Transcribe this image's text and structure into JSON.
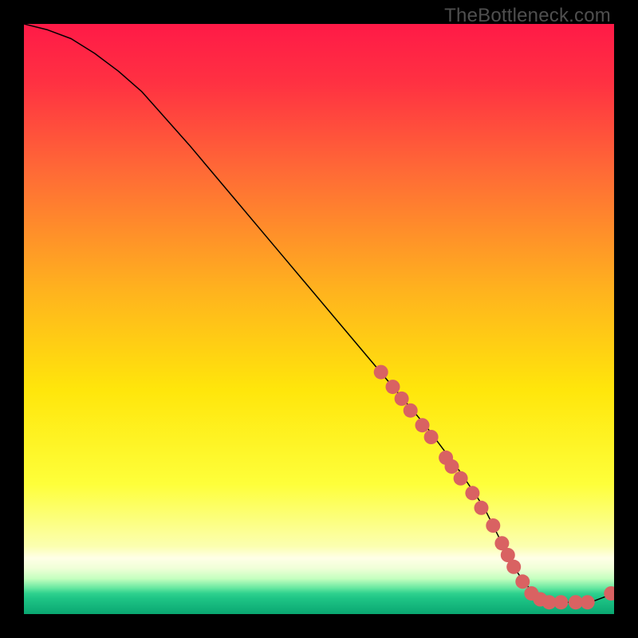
{
  "meta": {
    "watermark": "TheBottleneck.com"
  },
  "chart_data": {
    "type": "line",
    "title": "",
    "xlabel": "",
    "ylabel": "",
    "xlim": [
      0,
      100
    ],
    "ylim": [
      0,
      100
    ],
    "background_gradient": {
      "stops": [
        {
          "t": 0.0,
          "color": "#ff1a47"
        },
        {
          "t": 0.1,
          "color": "#ff3142"
        },
        {
          "t": 0.25,
          "color": "#ff6a36"
        },
        {
          "t": 0.45,
          "color": "#ffb21e"
        },
        {
          "t": 0.62,
          "color": "#ffe60b"
        },
        {
          "t": 0.78,
          "color": "#feff3a"
        },
        {
          "t": 0.885,
          "color": "#fbffb0"
        },
        {
          "t": 0.905,
          "color": "#ffffe7"
        },
        {
          "t": 0.922,
          "color": "#f0ffd8"
        },
        {
          "t": 0.94,
          "color": "#c4ffbf"
        },
        {
          "t": 0.956,
          "color": "#66e7a0"
        },
        {
          "t": 0.965,
          "color": "#2fd18e"
        },
        {
          "t": 0.973,
          "color": "#1fc586"
        },
        {
          "t": 1.0,
          "color": "#0aa771"
        }
      ]
    },
    "series": [
      {
        "name": "bottleneck-curve",
        "stroke": "#000000",
        "stroke_width": 1.5,
        "x": [
          0,
          4,
          8,
          12,
          16,
          20,
          28,
          36,
          44,
          52,
          60,
          68,
          74,
          78,
          81,
          83,
          85,
          88,
          92,
          96,
          100
        ],
        "y": [
          100,
          99,
          97.5,
          95,
          92,
          88.5,
          79.5,
          70,
          60.5,
          51,
          41.5,
          32,
          24,
          18,
          12,
          8,
          5,
          2.5,
          2,
          2,
          3.5
        ]
      }
    ],
    "markers": {
      "name": "highlight-points",
      "color": "#d96262",
      "radius": 9,
      "points": [
        {
          "x": 60.5,
          "y": 41
        },
        {
          "x": 62.5,
          "y": 38.5
        },
        {
          "x": 64.0,
          "y": 36.5
        },
        {
          "x": 65.5,
          "y": 34.5
        },
        {
          "x": 67.5,
          "y": 32
        },
        {
          "x": 69.0,
          "y": 30
        },
        {
          "x": 71.5,
          "y": 26.5
        },
        {
          "x": 72.5,
          "y": 25
        },
        {
          "x": 74.0,
          "y": 23
        },
        {
          "x": 76.0,
          "y": 20.5
        },
        {
          "x": 77.5,
          "y": 18
        },
        {
          "x": 79.5,
          "y": 15
        },
        {
          "x": 81.0,
          "y": 12
        },
        {
          "x": 82.0,
          "y": 10
        },
        {
          "x": 83.0,
          "y": 8
        },
        {
          "x": 84.5,
          "y": 5.5
        },
        {
          "x": 86.0,
          "y": 3.5
        },
        {
          "x": 87.5,
          "y": 2.5
        },
        {
          "x": 89.0,
          "y": 2
        },
        {
          "x": 91.0,
          "y": 2
        },
        {
          "x": 93.5,
          "y": 2
        },
        {
          "x": 95.5,
          "y": 2
        },
        {
          "x": 99.5,
          "y": 3.5
        }
      ]
    }
  }
}
